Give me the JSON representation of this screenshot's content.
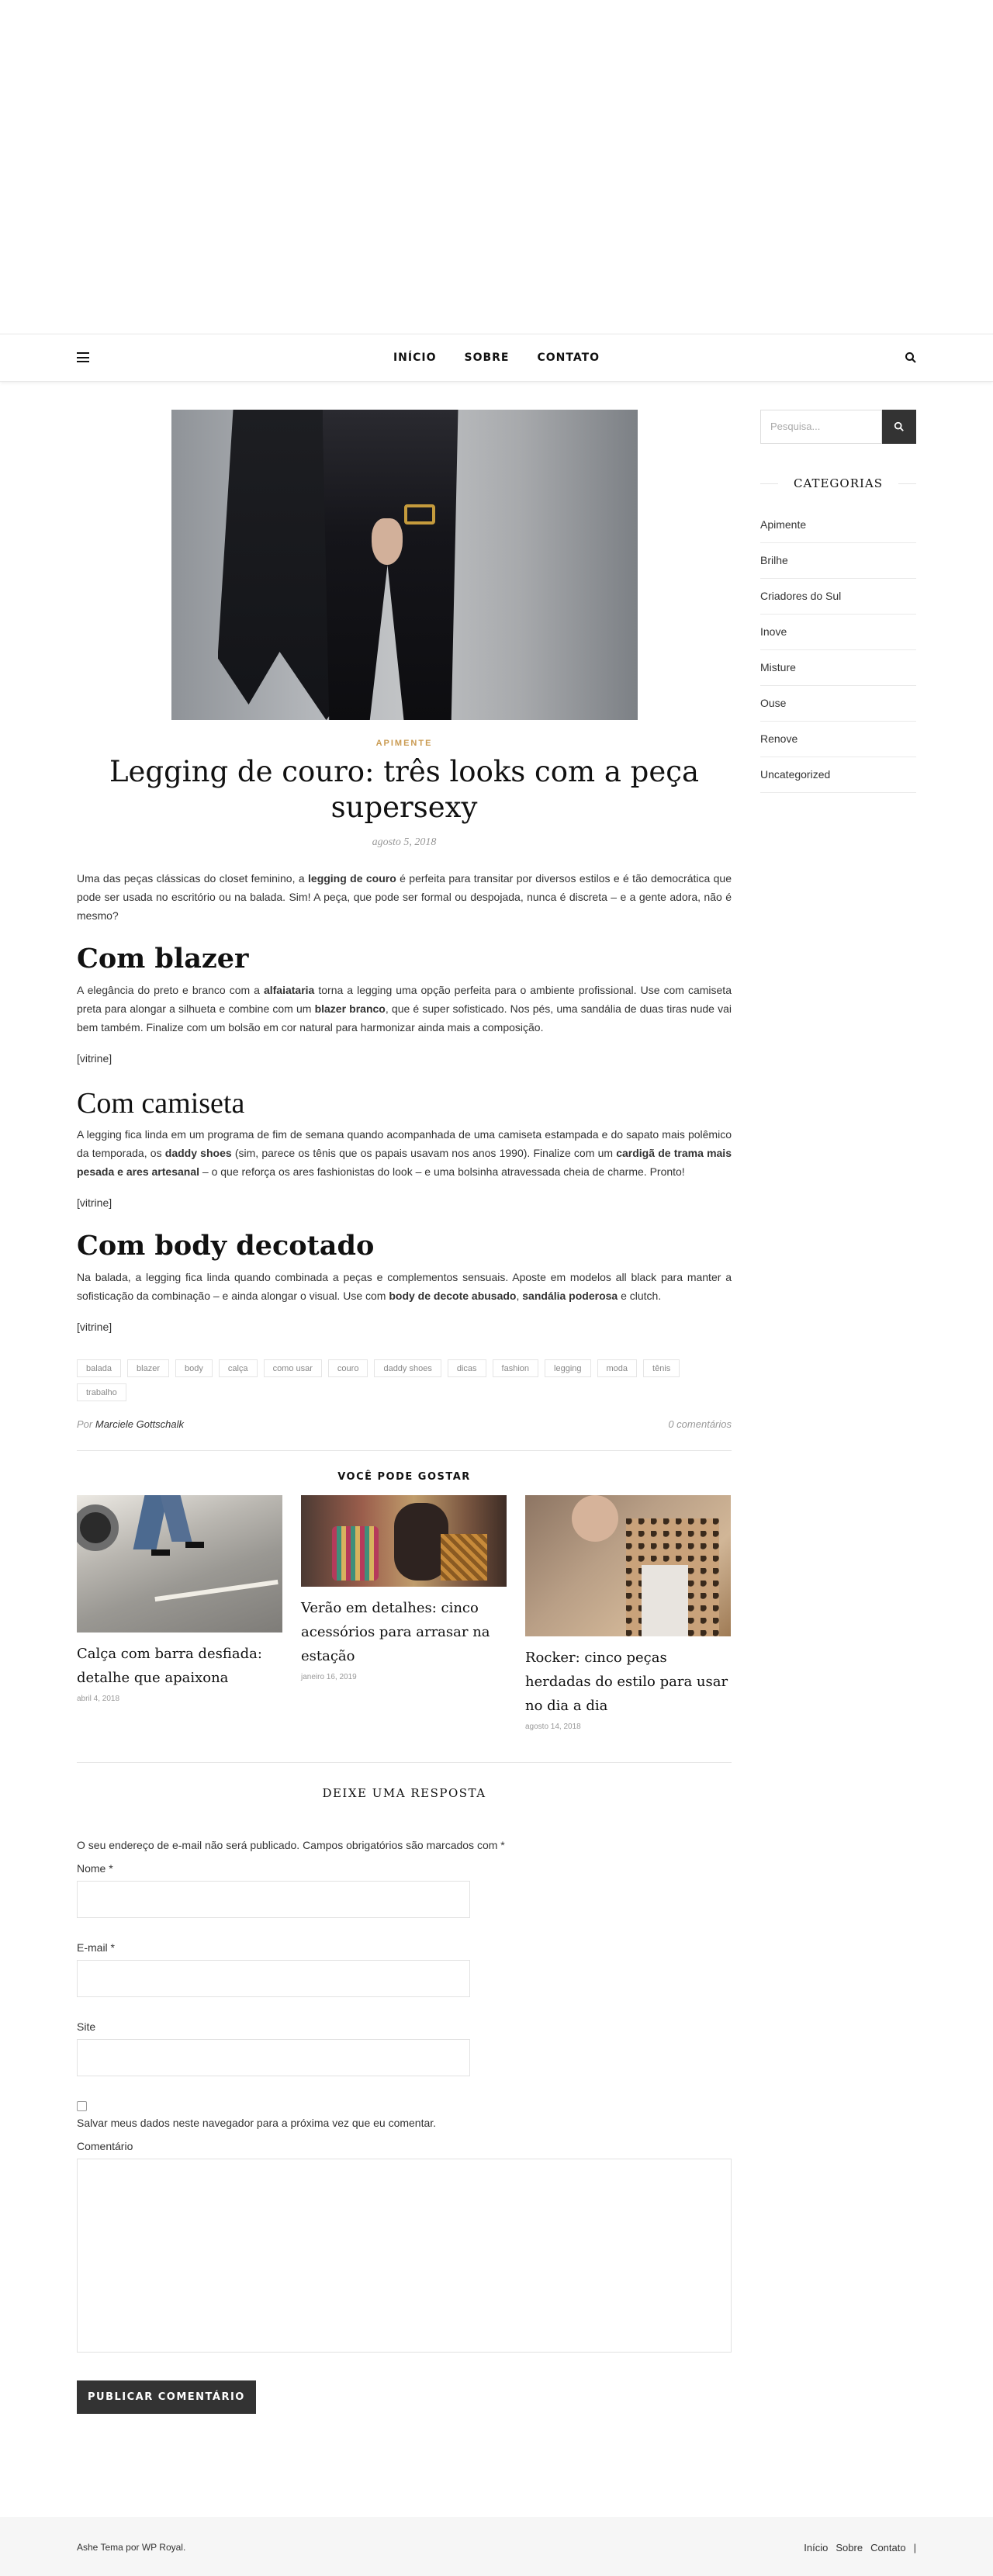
{
  "nav": {
    "items": [
      "INÍCIO",
      "SOBRE",
      "CONTATO"
    ]
  },
  "post": {
    "category": "APIMENTE",
    "title": "Legging de couro: três looks com a peça supersexy",
    "date": "agosto 5, 2018",
    "intro": [
      {
        "t": "Uma das peças clássicas do closet feminino, a "
      },
      {
        "t": "legging de couro",
        "b": true
      },
      {
        "t": " é perfeita para transitar por diversos estilos e  é tão democrática que pode ser usada no escritório ou na balada. Sim! A peça, que pode ser formal ou despojada, nunca é discreta – e a gente adora, não é mesmo?"
      }
    ],
    "sections": [
      {
        "heading": "Com blazer",
        "style": "bold",
        "text": [
          {
            "t": "A elegância do preto e branco com a "
          },
          {
            "t": "alfaiataria",
            "b": true
          },
          {
            "t": " torna a legging uma opção perfeita para o ambiente profissional. Use com camiseta preta para alongar a silhueta e combine com um "
          },
          {
            "t": "blazer branco",
            "b": true
          },
          {
            "t": ", que é super sofisticado. Nos pés, uma sandália de duas tiras nude vai bem também. Finalize com um bolsão em cor natural para harmonizar ainda mais a composição."
          }
        ],
        "vitrine": "[vitrine]"
      },
      {
        "heading": "Com camiseta",
        "style": "light",
        "text": [
          {
            "t": "A legging fica linda em um programa de fim de semana quando acompanhada de uma camiseta estampada e do sapato mais polêmico da temporada, os "
          },
          {
            "t": "daddy shoes",
            "b": true
          },
          {
            "t": " (sim, parece os tênis que os papais usavam nos anos 1990). Finalize com um "
          },
          {
            "t": "cardigã de trama mais pesada e ares artesanal",
            "b": true
          },
          {
            "t": " – o que reforça os ares fashionistas do look – e uma bolsinha atravessada cheia de charme. Pronto!"
          }
        ],
        "vitrine": "[vitrine]"
      },
      {
        "heading": "Com body decotado",
        "style": "bold",
        "text": [
          {
            "t": "Na balada, a legging fica linda quando combinada a peças e complementos sensuais. Aposte em modelos all black para manter a sofisticação da combinação – e ainda alongar o visual. Use com "
          },
          {
            "t": "body de decote abusado",
            "b": true
          },
          {
            "t": ", "
          },
          {
            "t": "sandália poderosa",
            "b": true
          },
          {
            "t": " e clutch."
          }
        ],
        "vitrine": "[vitrine]"
      }
    ],
    "tags": [
      "balada",
      "blazer",
      "body",
      "calça",
      "como usar",
      "couro",
      "daddy shoes",
      "dicas",
      "fashion",
      "legging",
      "moda",
      "tênis",
      "trabalho"
    ],
    "author_prefix": "Por",
    "author": "Marciele Gottschalk",
    "comments": "0 comentários"
  },
  "related": {
    "title": "VOCÊ PODE GOSTAR",
    "items": [
      {
        "title": "Calça com barra desfiada: detalhe que apaixona",
        "date": "abril 4, 2018"
      },
      {
        "title": "Verão em detalhes: cinco acessórios para arrasar na estação",
        "date": "janeiro 16, 2019"
      },
      {
        "title": "Rocker: cinco peças herdadas do estilo para usar no dia a dia",
        "date": "agosto 14, 2018"
      }
    ]
  },
  "reply": {
    "title": "DEIXE UMA RESPOSTA",
    "note": "O seu endereço de e-mail não será publicado. Campos obrigatórios são marcados com *",
    "name_label": "Nome *",
    "email_label": "E-mail *",
    "site_label": "Site",
    "save_label": "Salvar meus dados neste navegador para a próxima vez que eu comentar.",
    "comment_label": "Comentário",
    "submit": "PUBLICAR COMENTÁRIO"
  },
  "sidebar": {
    "search_placeholder": "Pesquisa...",
    "categories_title": "CATEGORIAS",
    "categories": [
      "Apimente",
      "Brilhe",
      "Criadores do Sul",
      "Inove",
      "Misture",
      "Ouse",
      "Renove",
      "Uncategorized"
    ]
  },
  "footer": {
    "credit": "Ashe Tema por WP Royal.",
    "links": [
      "Início",
      "Sobre",
      "Contato",
      "|"
    ]
  },
  "colors": {
    "accent": "#ca9b52",
    "dark": "#333333"
  }
}
